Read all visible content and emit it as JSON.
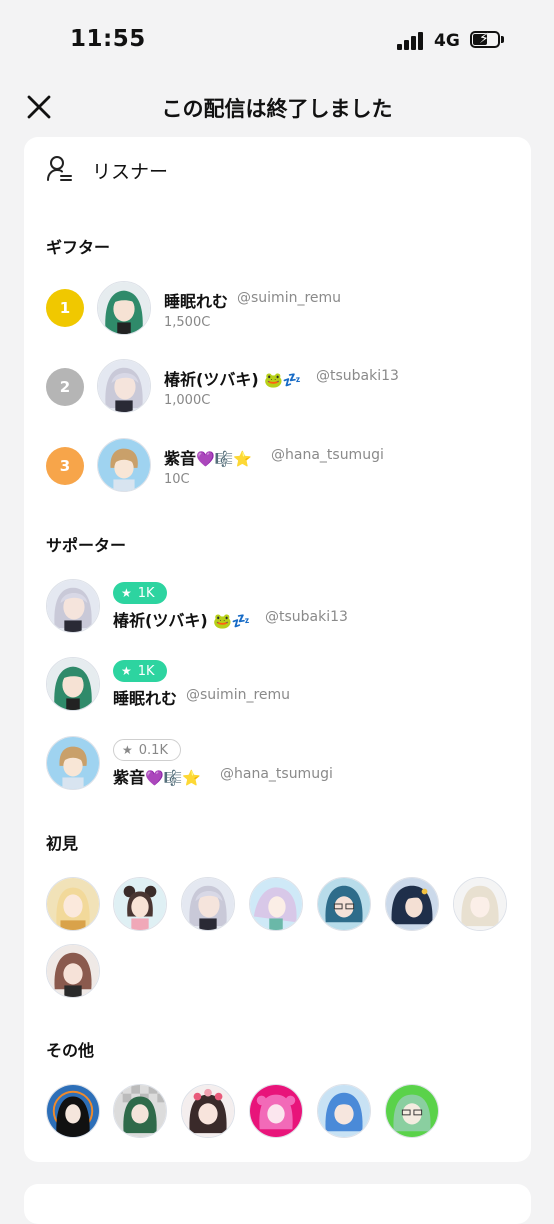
{
  "status_bar": {
    "time": "11:55",
    "network": "4G"
  },
  "nav": {
    "title": "この配信は終了しました"
  },
  "listener": {
    "label": "リスナー"
  },
  "gifter": {
    "title": "ギフター",
    "rows": [
      {
        "rank": "1",
        "name": "睡眠れむ",
        "emoji": "",
        "handle": "@suimin_remu",
        "amount": "1,500C",
        "rank_color": "#f0c800"
      },
      {
        "rank": "2",
        "name": "椿祈(ツバキ)",
        "emoji": "🐸💤",
        "handle": "@tsubaki13",
        "amount": "1,000C",
        "rank_color": "#b5b5b5"
      },
      {
        "rank": "3",
        "name": "紫音",
        "emoji": "💜🎼⭐",
        "handle": "@hana_tsumugi",
        "amount": "10C",
        "rank_color": "#f7a54a"
      }
    ]
  },
  "supporter": {
    "title": "サポーター",
    "rows": [
      {
        "badge": "1K",
        "name": "椿祈(ツバキ)",
        "emoji": "🐸💤",
        "handle": "@tsubaki13"
      },
      {
        "badge": "1K",
        "name": "睡眠れむ",
        "emoji": "",
        "handle": "@suimin_remu"
      },
      {
        "badge": "0.1K",
        "name": "紫音",
        "emoji": "💜🎼⭐",
        "handle": "@hana_tsumugi"
      }
    ]
  },
  "first_time": {
    "title": "初見",
    "count": 8
  },
  "others": {
    "title": "その他",
    "count": 6
  },
  "icons": {
    "close": "close-icon",
    "listener": "person-list-icon",
    "star": "star-icon"
  }
}
